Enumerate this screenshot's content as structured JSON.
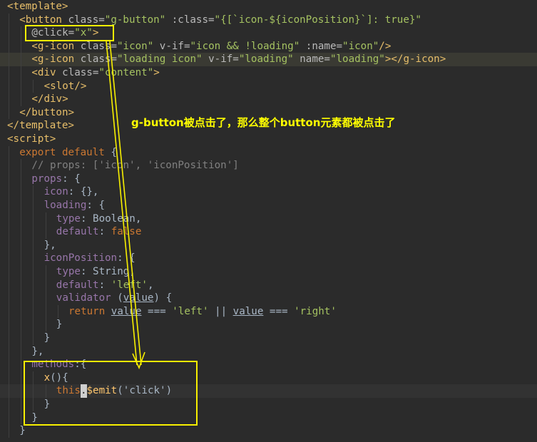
{
  "annotation": {
    "text": "g-button被点击了，那么整个button元素都被点击了",
    "color": "#ffff00"
  },
  "colors": {
    "background": "#2b2b2b",
    "highlight_box": "#f8f000",
    "tag": "#e8bf6a",
    "attr": "#bababa",
    "string": "#a5c261",
    "keyword": "#cc7832",
    "comment": "#808080",
    "property": "#9876aa"
  },
  "code_lines": [
    {
      "indent": 0,
      "tokens": [
        {
          "t": "<template>",
          "c": "tag"
        }
      ]
    },
    {
      "indent": 1,
      "tokens": [
        {
          "t": "<button ",
          "c": "tag"
        },
        {
          "t": "class=",
          "c": "attr"
        },
        {
          "t": "\"g-button\"",
          "c": "str"
        },
        {
          "t": " :class=",
          "c": "attr"
        },
        {
          "t": "\"{[`icon-${iconPosition}`]: true}\"",
          "c": "str"
        }
      ]
    },
    {
      "indent": 2,
      "tokens": [
        {
          "t": "@click=",
          "c": "attr"
        },
        {
          "t": "\"x\"",
          "c": "str"
        },
        {
          "t": ">",
          "c": "tag"
        }
      ]
    },
    {
      "indent": 2,
      "tokens": [
        {
          "t": "<g-icon ",
          "c": "tag"
        },
        {
          "t": "class=",
          "c": "attr"
        },
        {
          "t": "\"icon\"",
          "c": "str"
        },
        {
          "t": " v-if=",
          "c": "attr"
        },
        {
          "t": "\"icon && !loading\"",
          "c": "str"
        },
        {
          "t": " :name=",
          "c": "attr"
        },
        {
          "t": "\"icon\"",
          "c": "str"
        },
        {
          "t": "/>",
          "c": "tag"
        }
      ]
    },
    {
      "indent": 2,
      "highlight": true,
      "tokens": [
        {
          "t": "<g-icon ",
          "c": "tag"
        },
        {
          "t": "class=",
          "c": "attr"
        },
        {
          "t": "\"loading icon\"",
          "c": "str"
        },
        {
          "t": " v-if=",
          "c": "attr"
        },
        {
          "t": "\"loading\"",
          "c": "str"
        },
        {
          "t": " name=",
          "c": "attr"
        },
        {
          "t": "\"loading\"",
          "c": "str"
        },
        {
          "t": "></g-icon>",
          "c": "tag"
        }
      ]
    },
    {
      "indent": 2,
      "tokens": [
        {
          "t": "<div ",
          "c": "tag"
        },
        {
          "t": "class=",
          "c": "attr"
        },
        {
          "t": "\"content\"",
          "c": "str"
        },
        {
          "t": ">",
          "c": "tag"
        }
      ]
    },
    {
      "indent": 3,
      "tokens": [
        {
          "t": "<slot/>",
          "c": "tag"
        }
      ]
    },
    {
      "indent": 2,
      "tokens": [
        {
          "t": "</div>",
          "c": "tag"
        }
      ]
    },
    {
      "indent": 1,
      "tokens": [
        {
          "t": "</button>",
          "c": "tag"
        }
      ]
    },
    {
      "indent": 0,
      "tokens": [
        {
          "t": "</template>",
          "c": "tag"
        }
      ]
    },
    {
      "indent": 0,
      "tokens": [
        {
          "t": "<script>",
          "c": "tag"
        }
      ]
    },
    {
      "indent": 1,
      "tokens": [
        {
          "t": "export default ",
          "c": "kw"
        },
        {
          "t": "{",
          "c": "txt"
        }
      ]
    },
    {
      "indent": 2,
      "tokens": [
        {
          "t": "// props: ['icon', 'iconPosition']",
          "c": "cmt"
        }
      ]
    },
    {
      "indent": 2,
      "tokens": [
        {
          "t": "props",
          "c": "prop"
        },
        {
          "t": ": {",
          "c": "txt"
        }
      ]
    },
    {
      "indent": 3,
      "tokens": [
        {
          "t": "icon",
          "c": "prop"
        },
        {
          "t": ": {},",
          "c": "txt"
        }
      ]
    },
    {
      "indent": 3,
      "tokens": [
        {
          "t": "loading",
          "c": "prop"
        },
        {
          "t": ": {",
          "c": "txt"
        }
      ]
    },
    {
      "indent": 4,
      "tokens": [
        {
          "t": "type",
          "c": "prop"
        },
        {
          "t": ": Boolean,",
          "c": "txt"
        }
      ]
    },
    {
      "indent": 4,
      "tokens": [
        {
          "t": "default",
          "c": "prop"
        },
        {
          "t": ": ",
          "c": "txt"
        },
        {
          "t": "false",
          "c": "kw"
        }
      ]
    },
    {
      "indent": 3,
      "tokens": [
        {
          "t": "},",
          "c": "txt"
        }
      ]
    },
    {
      "indent": 3,
      "tokens": [
        {
          "t": "iconPosition",
          "c": "prop"
        },
        {
          "t": ": {",
          "c": "txt"
        }
      ]
    },
    {
      "indent": 4,
      "tokens": [
        {
          "t": "type",
          "c": "prop"
        },
        {
          "t": ": String,",
          "c": "txt"
        }
      ]
    },
    {
      "indent": 4,
      "tokens": [
        {
          "t": "default",
          "c": "prop"
        },
        {
          "t": ": ",
          "c": "txt"
        },
        {
          "t": "'left'",
          "c": "str"
        },
        {
          "t": ",",
          "c": "txt"
        }
      ]
    },
    {
      "indent": 4,
      "tokens": [
        {
          "t": "validator ",
          "c": "prop"
        },
        {
          "t": "(",
          "c": "txt"
        },
        {
          "t": "value",
          "c": "txt",
          "u": true
        },
        {
          "t": ") {",
          "c": "txt"
        }
      ]
    },
    {
      "indent": 5,
      "tokens": [
        {
          "t": "return ",
          "c": "kw"
        },
        {
          "t": "value",
          "c": "txt",
          "u": true
        },
        {
          "t": " === ",
          "c": "txt"
        },
        {
          "t": "'left'",
          "c": "str"
        },
        {
          "t": " || ",
          "c": "txt"
        },
        {
          "t": "value",
          "c": "txt",
          "u": true
        },
        {
          "t": " === ",
          "c": "txt"
        },
        {
          "t": "'right'",
          "c": "str"
        }
      ]
    },
    {
      "indent": 4,
      "tokens": [
        {
          "t": "}",
          "c": "txt"
        }
      ]
    },
    {
      "indent": 3,
      "tokens": [
        {
          "t": "}",
          "c": "txt"
        }
      ]
    },
    {
      "indent": 2,
      "tokens": [
        {
          "t": "},",
          "c": "txt"
        }
      ]
    },
    {
      "indent": 2,
      "tokens": [
        {
          "t": "methods",
          "c": "prop"
        },
        {
          "t": ":{",
          "c": "txt"
        }
      ]
    },
    {
      "indent": 3,
      "tokens": [
        {
          "t": "x",
          "c": "fn"
        },
        {
          "t": "(){",
          "c": "txt"
        }
      ]
    },
    {
      "indent": 4,
      "current": true,
      "tokens": [
        {
          "t": "this",
          "c": "kw"
        },
        {
          "t": ".",
          "c": "caret"
        },
        {
          "t": "$emit",
          "c": "fn"
        },
        {
          "t": "('click')",
          "c": "txt"
        }
      ]
    },
    {
      "indent": 3,
      "tokens": [
        {
          "t": "}",
          "c": "txt"
        }
      ]
    },
    {
      "indent": 2,
      "tokens": [
        {
          "t": "}",
          "c": "txt"
        }
      ]
    },
    {
      "indent": 1,
      "tokens": [
        {
          "t": "}",
          "c": "txt"
        }
      ]
    }
  ]
}
